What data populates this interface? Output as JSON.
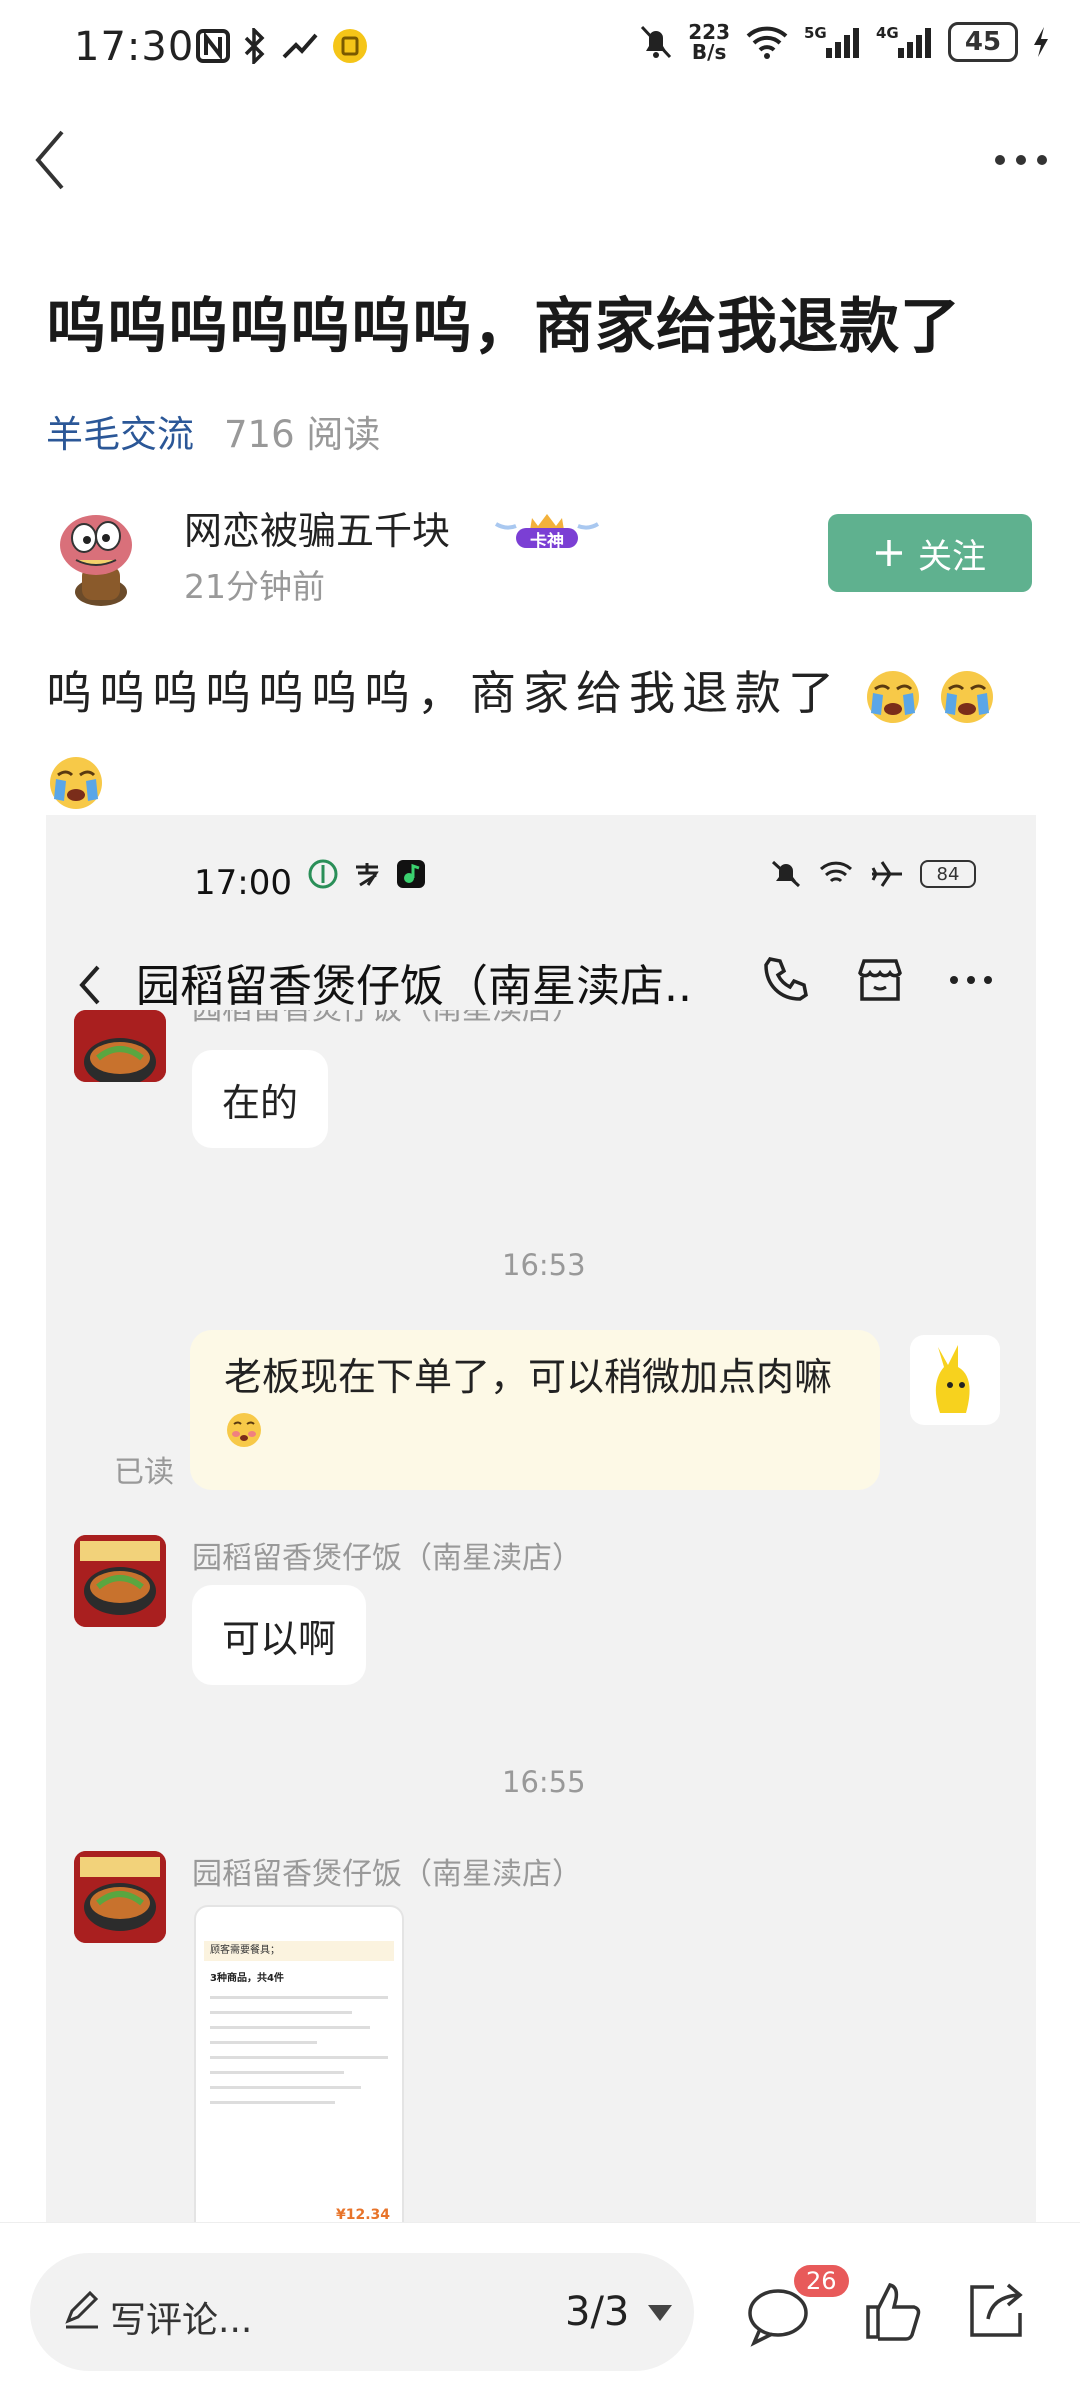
{
  "status_bar": {
    "time": "17:30",
    "net_speed_top": "223",
    "net_speed_bottom": "B/s",
    "battery": "45"
  },
  "post": {
    "title": "呜呜呜呜呜呜呜，商家给我退款了",
    "category": "羊毛交流",
    "reads": "716 阅读",
    "author_name": "网恋被骗五千块",
    "badge": "卡神",
    "posted_time": "21分钟前",
    "follow_label": "关注",
    "body": "呜呜呜呜呜呜呜，商家给我退款了"
  },
  "screenshot": {
    "status_time": "17:00",
    "battery": "84",
    "chat_title": "园稻留香煲仔饭（南星渎店..",
    "shop_name": "园稻留香煲仔饭（南星渎店）",
    "msg1": "在的",
    "time1": "16:53",
    "my_msg": "老板现在下单了，可以稍微加点肉嘛",
    "read_status": "已读",
    "msg2": "可以啊",
    "time2": "16:55",
    "receipt": {
      "title": "顾客需要餐具；",
      "summary": "3种商品，共4件",
      "income": "¥12.34"
    }
  },
  "bottom_bar": {
    "comment_placeholder": "写评论...",
    "page_indicator": "3/3",
    "comment_count": "26"
  },
  "colors": {
    "accent_green": "#5fb18f",
    "category_blue": "#2b5797",
    "badge_red": "#e85a5a"
  }
}
